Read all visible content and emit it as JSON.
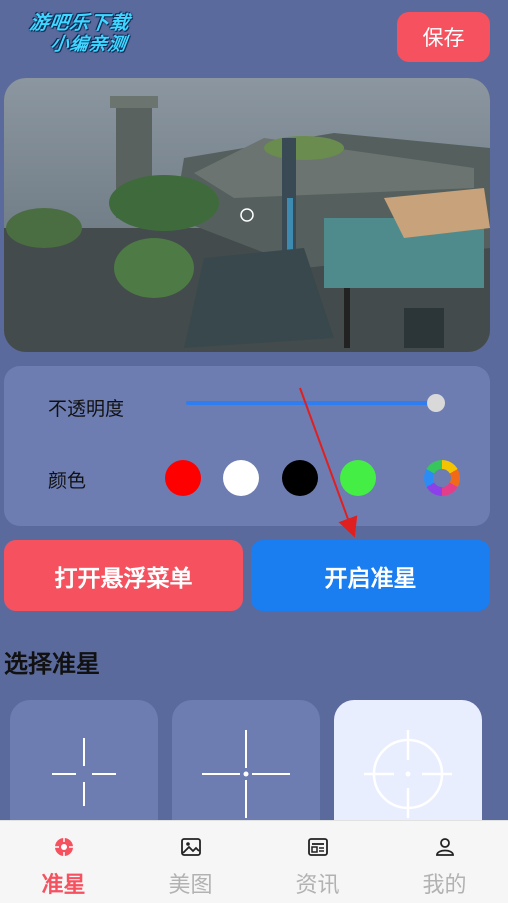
{
  "watermark": {
    "line1": "游吧乐下载",
    "line2": "小编亲测"
  },
  "header": {
    "save_label": "保存"
  },
  "settings": {
    "opacity_label": "不透明度",
    "opacity_value": 1.0,
    "color_label": "颜色",
    "colors": [
      "#ff0000",
      "#ffffff",
      "#000000",
      "#44ee44"
    ]
  },
  "buttons": {
    "floating_menu": "打开悬浮菜单",
    "enable_crosshair": "开启准星"
  },
  "section": {
    "title": "选择准星"
  },
  "tabs": [
    {
      "label": "准星",
      "icon": "crosshair-icon",
      "active": true
    },
    {
      "label": "美图",
      "icon": "image-icon",
      "active": false
    },
    {
      "label": "资讯",
      "icon": "news-icon",
      "active": false
    },
    {
      "label": "我的",
      "icon": "user-icon",
      "active": false
    }
  ],
  "colors": {
    "accent_red": "#f5515f",
    "accent_blue": "#1a7df0",
    "background": "#5b6a9d"
  }
}
